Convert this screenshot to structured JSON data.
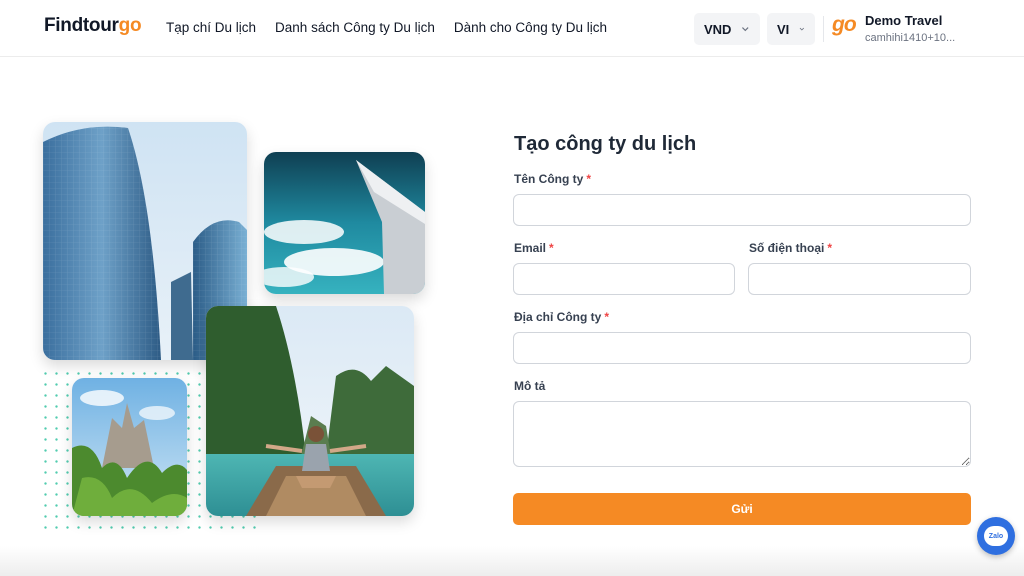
{
  "header": {
    "logo_main": "Findtour",
    "logo_accent": "go",
    "nav": [
      {
        "label": "Tạp chí Du lịch"
      },
      {
        "label": "Danh sách Công ty Du lịch"
      },
      {
        "label": "Dành cho Công ty Du lịch"
      }
    ],
    "currency": "VND",
    "language": "VI",
    "company_logo": "go",
    "company_name": "Demo Travel",
    "company_email": "camhihi1410+10..."
  },
  "form": {
    "title": "Tạo công ty du lịch",
    "required_mark": "*",
    "fields": {
      "company_name": {
        "label": "Tên Công ty",
        "value": "",
        "placeholder": ""
      },
      "email": {
        "label": "Email",
        "value": "",
        "placeholder": ""
      },
      "phone": {
        "label": "Số điện thoại",
        "value": "",
        "placeholder": ""
      },
      "address": {
        "label": "Địa chỉ Công ty",
        "value": "",
        "placeholder": ""
      },
      "description": {
        "label": "Mô tả",
        "value": "",
        "placeholder": ""
      }
    },
    "submit_label": "Gửi"
  },
  "chat_widget": {
    "label": "Zalo"
  },
  "colors": {
    "accent": "#f58a24",
    "dots": "#34c3a2",
    "required": "#ef4444",
    "chat": "#2f6fe0"
  },
  "icons": [
    "chevron-down-icon",
    "chevron-down-icon",
    "zalo-chat-icon"
  ]
}
